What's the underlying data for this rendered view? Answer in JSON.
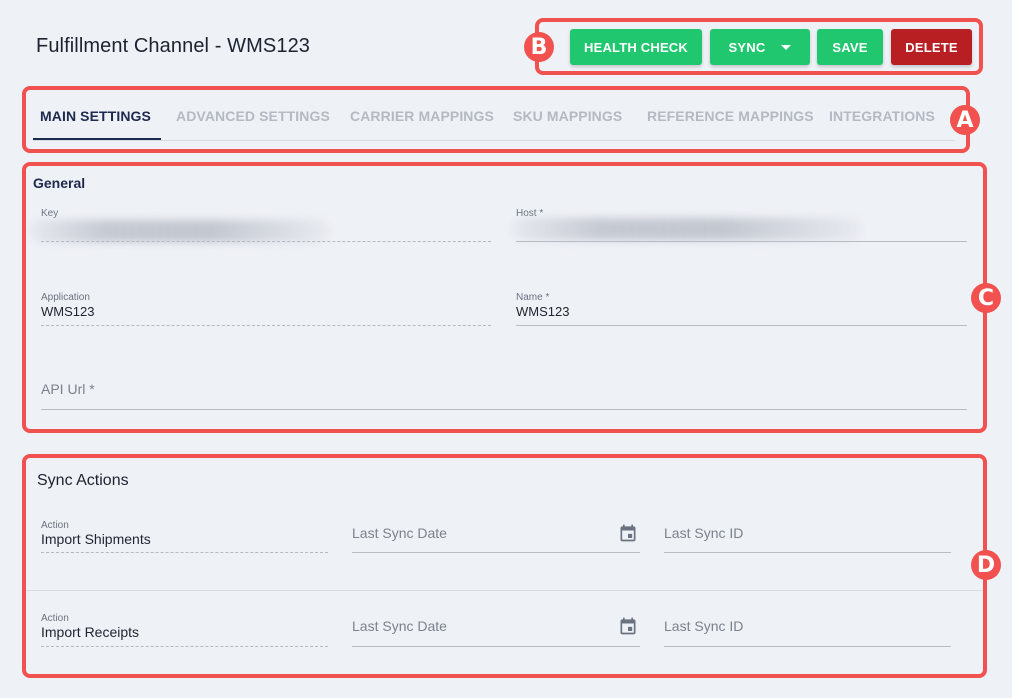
{
  "page": {
    "title": "Fulfillment Channel - WMS123"
  },
  "toolbar": {
    "health_check_label": "HEALTH CHECK",
    "sync_label": "SYNC",
    "save_label": "SAVE",
    "delete_label": "DELETE"
  },
  "tabs": [
    {
      "label": "MAIN SETTINGS",
      "active": true
    },
    {
      "label": "ADVANCED SETTINGS",
      "active": false
    },
    {
      "label": "CARRIER MAPPINGS",
      "active": false
    },
    {
      "label": "SKU MAPPINGS",
      "active": false
    },
    {
      "label": "REFERENCE MAPPINGS",
      "active": false
    },
    {
      "label": "INTEGRATIONS",
      "active": false
    }
  ],
  "general": {
    "title": "General",
    "key": {
      "label": "Key",
      "value": ""
    },
    "host": {
      "label": "Host *",
      "value": ""
    },
    "application": {
      "label": "Application",
      "value": "WMS123"
    },
    "name": {
      "label": "Name *",
      "value": "WMS123"
    },
    "api_url": {
      "placeholder": "API Url *"
    }
  },
  "sync_actions": {
    "title": "Sync Actions",
    "rows": [
      {
        "action_label": "Action",
        "action_value": "Import Shipments",
        "date_placeholder": "Last Sync Date",
        "id_placeholder": "Last Sync ID"
      },
      {
        "action_label": "Action",
        "action_value": "Import Receipts",
        "date_placeholder": "Last Sync Date",
        "id_placeholder": "Last Sync ID"
      }
    ]
  },
  "callouts": [
    "A",
    "B",
    "C",
    "D"
  ],
  "colors": {
    "accent_green": "#21c76f",
    "danger_red": "#b71f23",
    "callout": "#f1514f",
    "active_tab": "#1e2a4d"
  },
  "icons": [
    "calendar-icon",
    "chevron-down-icon"
  ]
}
